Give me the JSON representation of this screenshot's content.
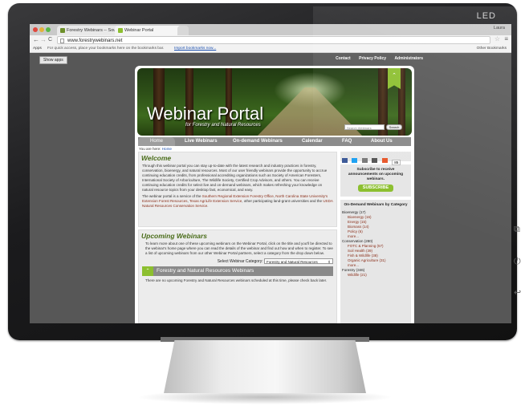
{
  "device": {
    "led_label": "LED"
  },
  "browser": {
    "tabs": [
      {
        "title": "Forestry Webinars -- Sout",
        "close": "×"
      },
      {
        "title": "Webinar Portal",
        "close": "×"
      }
    ],
    "user": "Laura",
    "back": "←",
    "forward": "→",
    "reload": "C",
    "url": "www.forestrywebinars.net",
    "star": "☆",
    "menu": "≡",
    "bookmarks": {
      "apps": "Apps",
      "hint": "For quick access, place your bookmarks here on the bookmarks bar.",
      "import": "Import bookmarks now...",
      "other": "Other Bookmarks"
    }
  },
  "page": {
    "show_apps": "Show apps",
    "top_links": [
      "Contact",
      "Privacy Policy",
      "Administrators"
    ],
    "banner": {
      "title": "Webinar Portal",
      "subtitle": "for Forestry and Natural Resources",
      "search_placeholder": "Search Webinars",
      "search_button": "Search"
    },
    "nav": [
      "Home",
      "Live Webinars",
      "On-demand Webinars",
      "Calendar",
      "FAQ",
      "About Us"
    ],
    "breadcrumb": {
      "prefix": "You are here:",
      "current": "Home"
    },
    "welcome": {
      "heading": "Welcome",
      "p1": "Through this webinar portal you can stay up-to-date with the latest research and industry practices in forestry, conservation, bioenergy, and natural resources. Most of our user friendly webinars provide the opportunity to accrue continuing education credits, from professional accrediting organizations such as Society of American Foresters, International Society of Arboriculture, The Wildlife Society, Certified Crop Advisors, and others. You can receive continuing education credits for select live and on-demand webinars, which makes refreshing your knowledge on natural resource topics from your desktop fast, economical, and easy.",
      "p2_start": "The webinar portal is a service of the ",
      "link1": "Southern Regional Extension Forestry Office",
      "sep1": ", ",
      "link2": "North Carolina State University's Extension Forest Resources",
      "sep2": ", ",
      "link3": "Texas AgriLife Extension Service",
      "p2_mid": ", other participating land-grant universities and the ",
      "link4": "USDA Natural Resources Conservation Service",
      "p2_end": "."
    },
    "upcoming": {
      "heading": "Upcoming Webinars",
      "text": "To learn more about one of these upcoming webinars on the Webinar Portal, click on the title and you'll be directed to the webinar's home page where you can read the details of the webinar and find out how and when to register. To see a list of upcoming webinars from our other Webinar Portal partners, select a category from the drop down below.",
      "select_label": "Select Webinar Category:",
      "select_value": "Forestry and Natural Resources",
      "category_title": "Forestry and Natural Resources Webinars",
      "empty_text": "There are no upcoming Forestry and Natural Resources webinars scheduled at this time, please check back later."
    },
    "sidebar": {
      "share_count": "85",
      "subscribe_text": "Subscribe to receive announcements on upcoming webinars.",
      "subscribe_button": "SUBSCRIBE",
      "ondemand_heading": "On-Demand Webinars by Category",
      "categories": [
        {
          "name": "Bioenergy (17)",
          "items": [
            "Bioenergy (16)",
            "Energy (15)",
            "Biomass (14)",
            "Policy (6)",
            "more..."
          ]
        },
        {
          "name": "Conservation (280)",
          "items": [
            "FOTC & Planning (57)",
            "Soil Health (39)",
            "Fish & Wildlife (38)",
            "Organic Agriculture (31)",
            "more..."
          ]
        },
        {
          "name": "Forestry (346)",
          "items": [
            "Wildlife (21)"
          ]
        }
      ]
    }
  },
  "colors": {
    "accent_green": "#8cbf2f",
    "heading_green": "#4a6d1a",
    "link_red": "#8b2f1a",
    "nav_gray": "#8a8a8a"
  }
}
